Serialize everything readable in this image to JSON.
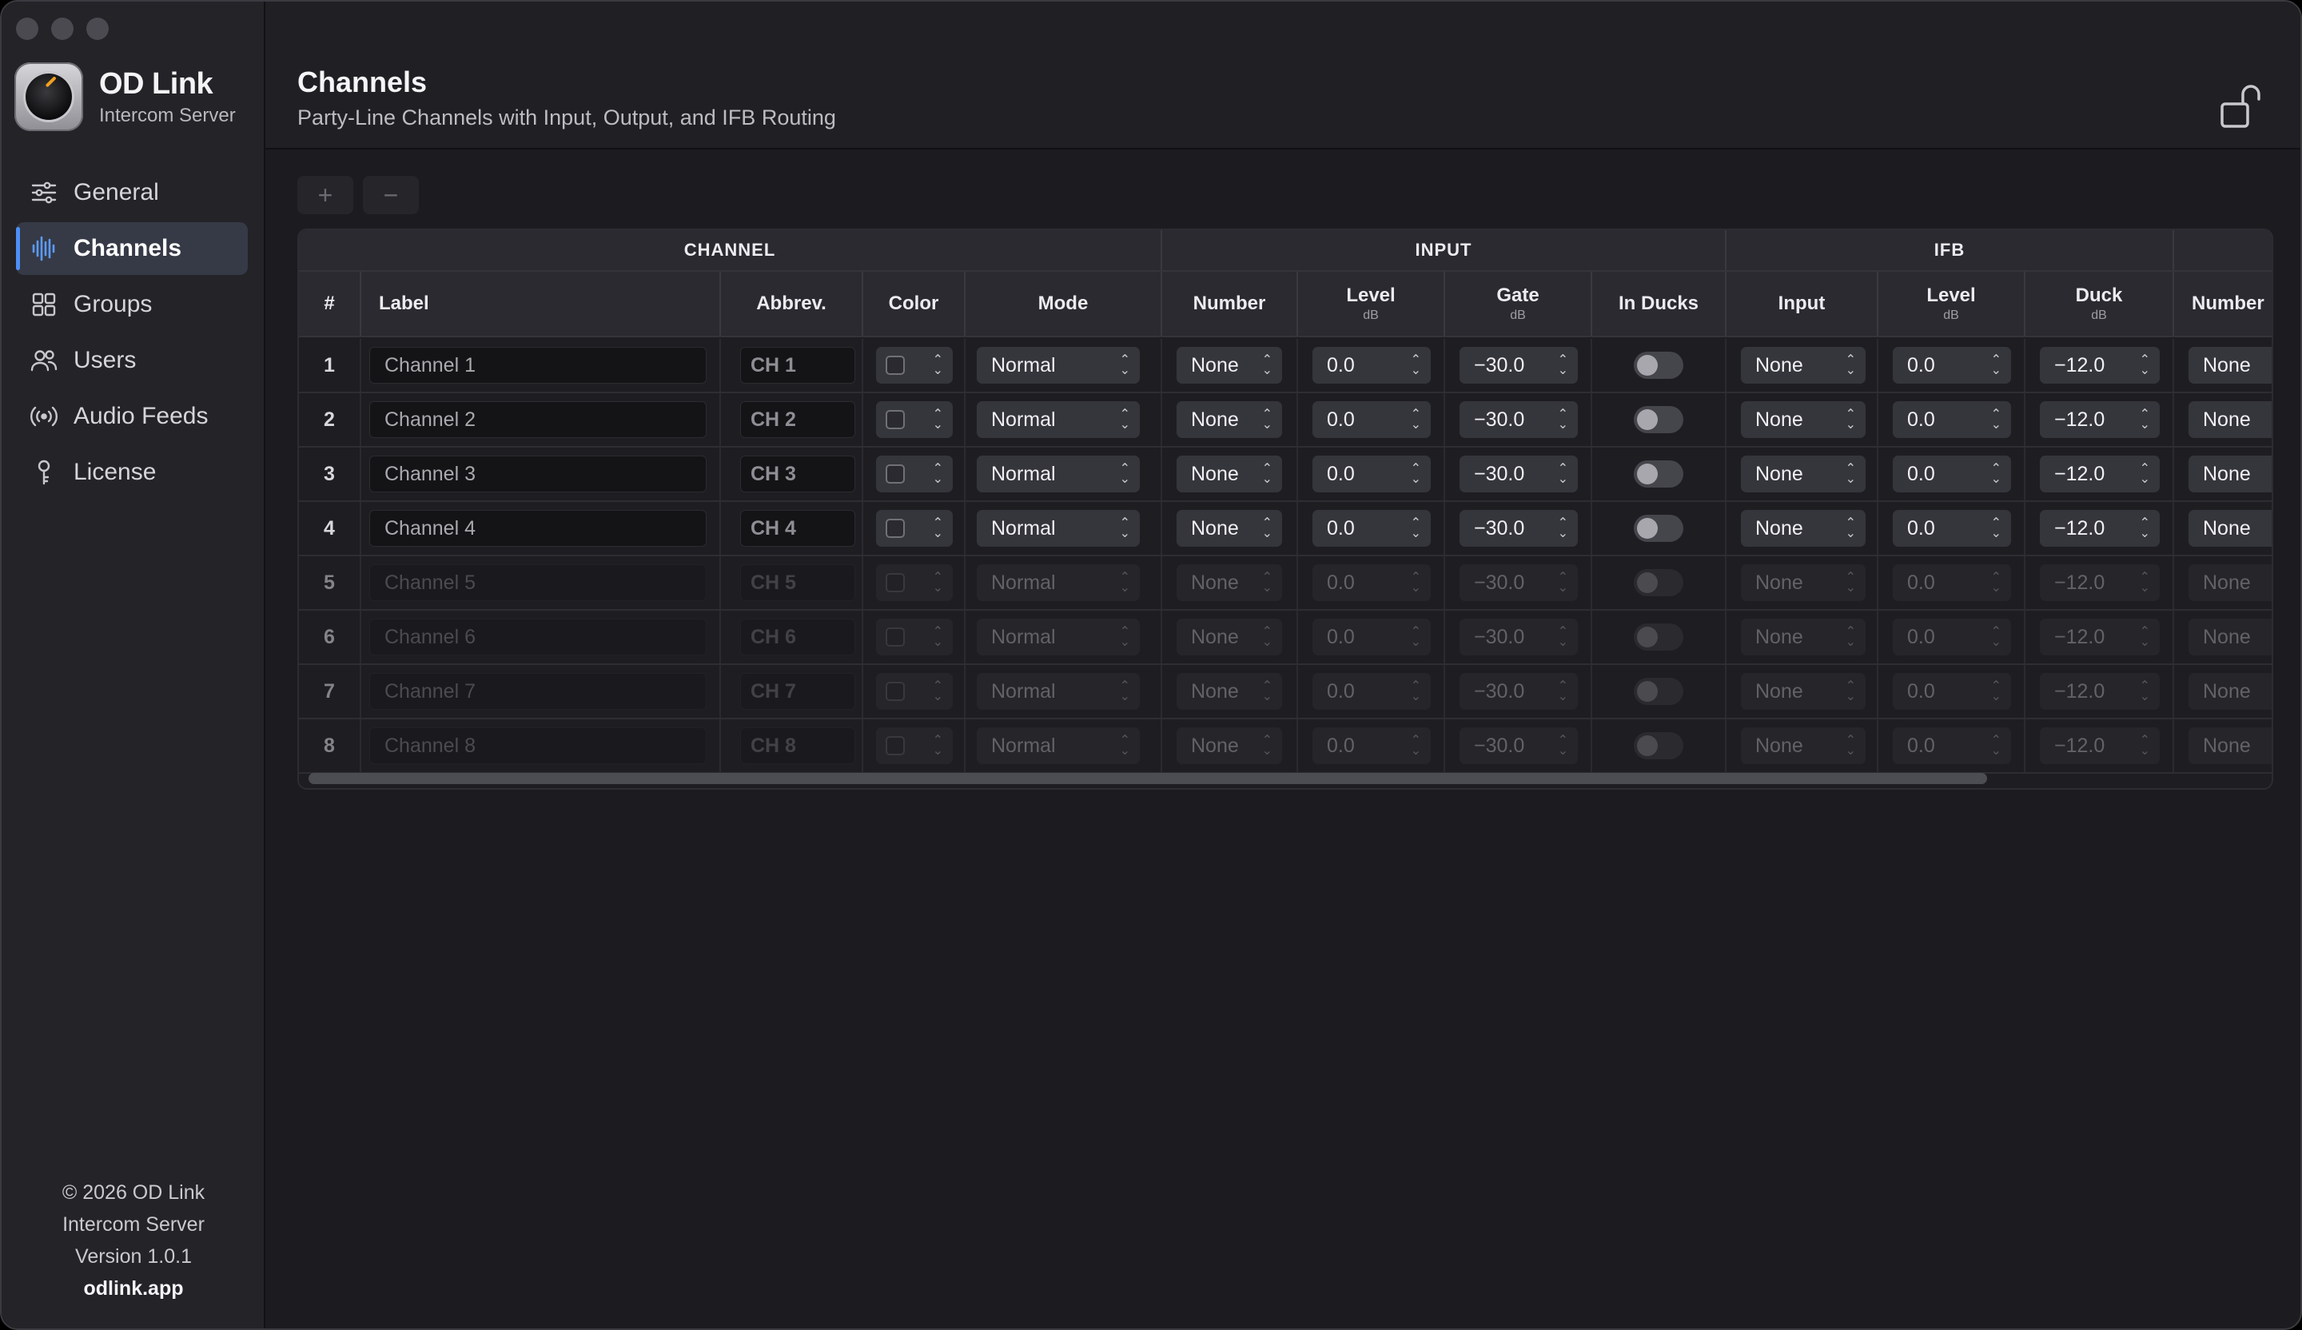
{
  "app": {
    "name": "OD Link",
    "subtitle": "Intercom Server"
  },
  "sidebar": {
    "items": [
      {
        "label": "General",
        "icon": "sliders-icon"
      },
      {
        "label": "Channels",
        "icon": "waveform-icon",
        "active": true
      },
      {
        "label": "Groups",
        "icon": "grid-icon"
      },
      {
        "label": "Users",
        "icon": "users-icon"
      },
      {
        "label": "Audio Feeds",
        "icon": "broadcast-icon"
      },
      {
        "label": "License",
        "icon": "key-icon"
      }
    ],
    "footer": {
      "copyright": "© 2026 OD Link",
      "product": "Intercom Server",
      "version": "Version 1.0.1",
      "website": "odlink.app"
    }
  },
  "header": {
    "title": "Channels",
    "subtitle": "Party-Line Channels with Input, Output, and IFB Routing",
    "lock_icon": "unlocked-padlock-icon"
  },
  "toolbar": {
    "add_label": "+",
    "remove_label": "−"
  },
  "table": {
    "groups": [
      "CHANNEL",
      "INPUT",
      "IFB",
      ""
    ],
    "columns": {
      "num": "#",
      "label": "Label",
      "abbrev": "Abbrev.",
      "color": "Color",
      "mode": "Mode",
      "in_number": "Number",
      "in_level": "Level",
      "in_gate": "Gate",
      "in_ducks": "In Ducks",
      "ifb_input": "Input",
      "ifb_level": "Level",
      "ifb_duck": "Duck",
      "out_number": "Number",
      "unit": "dB"
    },
    "rows": [
      {
        "num": "1",
        "label": "Channel 1",
        "abbrev": "CH 1",
        "mode": "Normal",
        "in_number": "None",
        "in_level": "0.0",
        "in_gate": "−30.0",
        "ifb_input": "None",
        "ifb_level": "0.0",
        "ifb_duck": "−12.0",
        "out_number": "None",
        "enabled": true
      },
      {
        "num": "2",
        "label": "Channel 2",
        "abbrev": "CH 2",
        "mode": "Normal",
        "in_number": "None",
        "in_level": "0.0",
        "in_gate": "−30.0",
        "ifb_input": "None",
        "ifb_level": "0.0",
        "ifb_duck": "−12.0",
        "out_number": "None",
        "enabled": true
      },
      {
        "num": "3",
        "label": "Channel 3",
        "abbrev": "CH 3",
        "mode": "Normal",
        "in_number": "None",
        "in_level": "0.0",
        "in_gate": "−30.0",
        "ifb_input": "None",
        "ifb_level": "0.0",
        "ifb_duck": "−12.0",
        "out_number": "None",
        "enabled": true
      },
      {
        "num": "4",
        "label": "Channel 4",
        "abbrev": "CH 4",
        "mode": "Normal",
        "in_number": "None",
        "in_level": "0.0",
        "in_gate": "−30.0",
        "ifb_input": "None",
        "ifb_level": "0.0",
        "ifb_duck": "−12.0",
        "out_number": "None",
        "enabled": true
      },
      {
        "num": "5",
        "label": "Channel 5",
        "abbrev": "CH 5",
        "mode": "Normal",
        "in_number": "None",
        "in_level": "0.0",
        "in_gate": "−30.0",
        "ifb_input": "None",
        "ifb_level": "0.0",
        "ifb_duck": "−12.0",
        "out_number": "None",
        "enabled": false
      },
      {
        "num": "6",
        "label": "Channel 6",
        "abbrev": "CH 6",
        "mode": "Normal",
        "in_number": "None",
        "in_level": "0.0",
        "in_gate": "−30.0",
        "ifb_input": "None",
        "ifb_level": "0.0",
        "ifb_duck": "−12.0",
        "out_number": "None",
        "enabled": false
      },
      {
        "num": "7",
        "label": "Channel 7",
        "abbrev": "CH 7",
        "mode": "Normal",
        "in_number": "None",
        "in_level": "0.0",
        "in_gate": "−30.0",
        "ifb_input": "None",
        "ifb_level": "0.0",
        "ifb_duck": "−12.0",
        "out_number": "None",
        "enabled": false
      },
      {
        "num": "8",
        "label": "Channel 8",
        "abbrev": "CH 8",
        "mode": "Normal",
        "in_number": "None",
        "in_level": "0.0",
        "in_gate": "−30.0",
        "ifb_input": "None",
        "ifb_level": "0.0",
        "ifb_duck": "−12.0",
        "out_number": "None",
        "enabled": false
      }
    ]
  },
  "colors": {
    "accent": "#4d8ef7",
    "background": "#1c1c20",
    "sidebar": "#232328"
  }
}
